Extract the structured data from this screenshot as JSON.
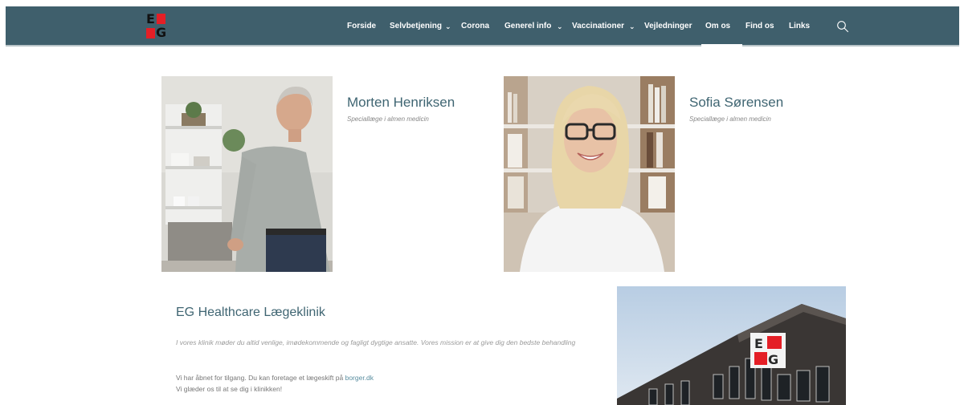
{
  "logo": {
    "letter_top": "E",
    "letter_bottom": "G"
  },
  "nav": {
    "items": [
      {
        "label": "Forside"
      },
      {
        "label": "Selvbetjening",
        "dropdown": true
      },
      {
        "label": "Corona"
      },
      {
        "label": "Generel info",
        "dropdown": true
      },
      {
        "label": "Vaccinationer",
        "dropdown": true
      },
      {
        "label": "Vejledninger"
      },
      {
        "label": "Om os",
        "active": true
      },
      {
        "label": "Find os"
      },
      {
        "label": "Links"
      }
    ],
    "chevron": "⌄",
    "search_icon": "search-icon"
  },
  "doctors": [
    {
      "name": "Morten Henriksen",
      "role": "Speciallæge i almen medicin"
    },
    {
      "name": "Sofia Sørensen",
      "role": "Speciallæge i almen medicin"
    }
  ],
  "clinic": {
    "title": "EG Healthcare Lægeklinik",
    "intro": "I vores klinik møder du altid venlige, imødekommende og fagligt dygtige ansatte. Vores mission er at give dig den bedste behandling",
    "text_line1_prefix": "Vi har åbnet for tilgang. Du kan foretage et lægeskift på ",
    "link": "borger.dk",
    "text_line2": "Vi glæder os til at se dig i klinikken!",
    "building_logo_top": "E",
    "building_logo_bottom": "G"
  },
  "colors": {
    "header_bg": "#3f5f6c",
    "brand_red": "#e41f26",
    "heading_teal": "#3f6572",
    "link": "#5a8ea0"
  }
}
